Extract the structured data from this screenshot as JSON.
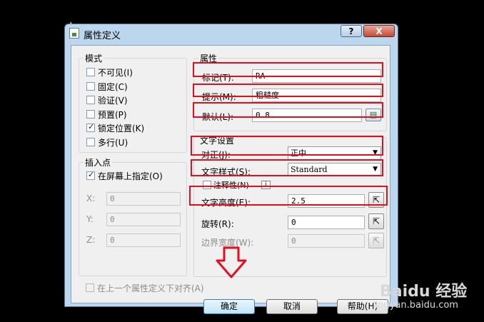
{
  "window": {
    "title": "属性定义",
    "help_label": "?",
    "close_label": "X"
  },
  "mode": {
    "label": "模式",
    "options": [
      {
        "label": "不可见(I)",
        "checked": false
      },
      {
        "label": "固定(C)",
        "checked": false
      },
      {
        "label": "验证(V)",
        "checked": false
      },
      {
        "label": "预置(P)",
        "checked": false
      },
      {
        "label": "锁定位置(K)",
        "checked": true
      },
      {
        "label": "多行(U)",
        "checked": false
      }
    ]
  },
  "insertion_point": {
    "label": "插入点",
    "specify_on_screen": "在屏幕上指定(O)",
    "specify_checked": true,
    "x_label": "X:",
    "x_value": "0",
    "y_label": "Y:",
    "y_value": "0",
    "z_label": "Z:",
    "z_value": "0"
  },
  "attribute": {
    "label": "属性",
    "tag_label": "标记(T):",
    "tag_value": "RA",
    "prompt_label": "提示(M):",
    "prompt_value": "粗糙度",
    "default_label": "默认(L):",
    "default_value": "0.8"
  },
  "text_settings": {
    "label": "文字设置",
    "justify_label": "对正(J):",
    "justify_value": "正中",
    "style_label": "文字样式(S):",
    "style_value": "Standard",
    "annotative_label": "注释性(N)",
    "annotative_info": "i",
    "height_label": "文字高度(E):",
    "height_value": "2.5",
    "rotation_label": "旋转(R):",
    "rotation_value": "0",
    "boundary_label": "边界宽度(W):",
    "boundary_value": "0"
  },
  "align_below": "在上一个属性定义下对齐(A)",
  "buttons": {
    "ok": "确定",
    "cancel": "取消",
    "help": "帮助(H)"
  },
  "annotation_arrow_color": "#e0101e",
  "watermark": {
    "brand": "Baidu 经验",
    "site": "jingyan.baidu.com"
  }
}
